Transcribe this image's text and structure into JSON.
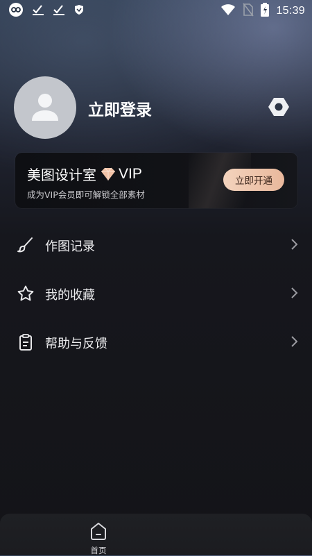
{
  "status_bar": {
    "time": "15:39",
    "left_icons": [
      "infinity-icon",
      "check-icon",
      "check-icon",
      "shield-icon"
    ],
    "right_icons": [
      "wifi-icon",
      "no-sim-icon",
      "battery-charging-icon"
    ]
  },
  "profile": {
    "login_label": "立即登录",
    "avatar_icon": "user-silhouette-icon",
    "settings_icon": "hexagon-settings-icon"
  },
  "vip_card": {
    "title": "美图设计室",
    "badge_icon": "diamond-icon",
    "badge_text": "VIP",
    "subtitle": "成为VIP会员即可解锁全部素材",
    "button_label": "立即开通",
    "accent": "#efc6ac"
  },
  "menu": {
    "items": [
      {
        "label": "作图记录",
        "icon": "brush-icon"
      },
      {
        "label": "我的收藏",
        "icon": "star-icon"
      },
      {
        "label": "帮助与反馈",
        "icon": "clipboard-icon"
      }
    ]
  },
  "tab_bar": {
    "home_label": "首页",
    "home_icon": "home-icon"
  }
}
